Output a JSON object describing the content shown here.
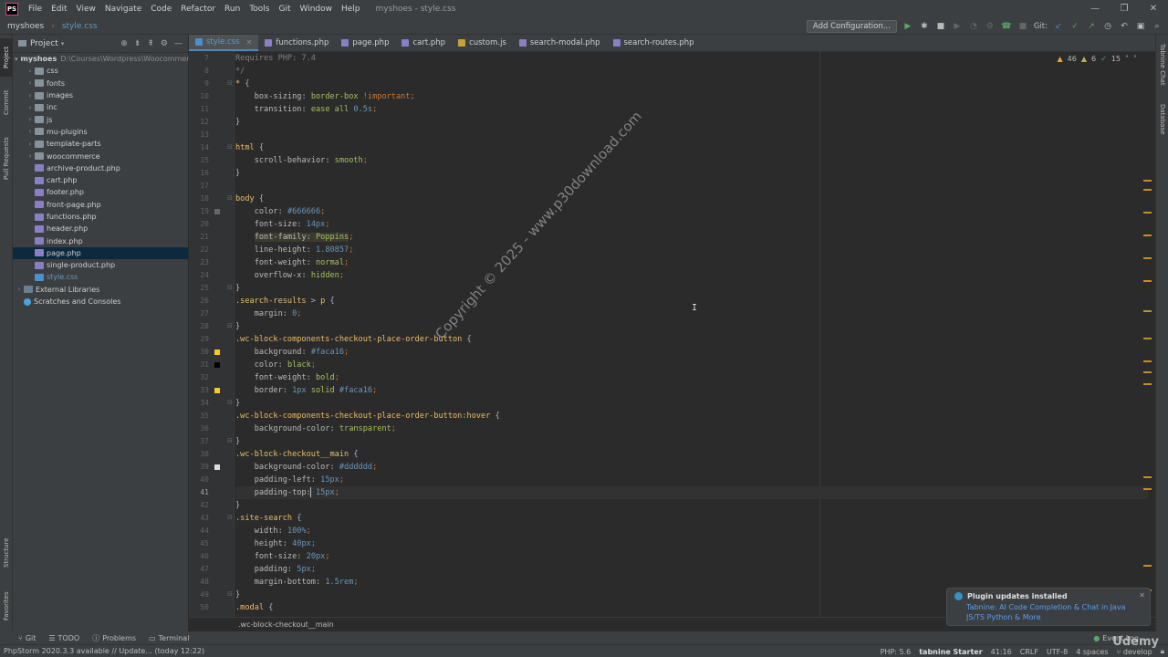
{
  "window": {
    "title": "myshoes - style.css",
    "menu": [
      "File",
      "Edit",
      "View",
      "Navigate",
      "Code",
      "Refactor",
      "Run",
      "Tools",
      "Git",
      "Window",
      "Help"
    ],
    "controls": [
      "—",
      "❐",
      "✕"
    ]
  },
  "navbar": {
    "project": "myshoes",
    "file": "style.css",
    "config_button": "Add Configuration...",
    "git_label": "Git:"
  },
  "project_panel": {
    "title": "Project",
    "root_name": "myshoes",
    "root_path": "D:\\Courses\\Wordpress\\Woocommerce",
    "items": [
      {
        "label": "css",
        "type": "folder"
      },
      {
        "label": "fonts",
        "type": "folder"
      },
      {
        "label": "images",
        "type": "folder"
      },
      {
        "label": "inc",
        "type": "folder"
      },
      {
        "label": "js",
        "type": "folder"
      },
      {
        "label": "mu-plugins",
        "type": "folder"
      },
      {
        "label": "template-parts",
        "type": "folder"
      },
      {
        "label": "woocommerce",
        "type": "folder"
      },
      {
        "label": "archive-product.php",
        "type": "php"
      },
      {
        "label": "cart.php",
        "type": "php"
      },
      {
        "label": "footer.php",
        "type": "php"
      },
      {
        "label": "front-page.php",
        "type": "php"
      },
      {
        "label": "functions.php",
        "type": "php"
      },
      {
        "label": "header.php",
        "type": "php"
      },
      {
        "label": "index.php",
        "type": "php"
      },
      {
        "label": "page.php",
        "type": "php"
      },
      {
        "label": "single-product.php",
        "type": "php"
      },
      {
        "label": "style.css",
        "type": "css"
      }
    ],
    "external_libraries": "External Libraries",
    "scratches": "Scratches and Consoles"
  },
  "left_strip": {
    "project": "Project",
    "commit": "Commit",
    "pull_requests": "Pull Requests",
    "structure": "Structure",
    "favorites": "Favorites"
  },
  "right_strip": {
    "tabnine": "Tabnine Chat",
    "database": "Database"
  },
  "tabs": [
    {
      "label": "style.css",
      "type": "css",
      "active": true
    },
    {
      "label": "functions.php",
      "type": "php",
      "active": false
    },
    {
      "label": "page.php",
      "type": "php",
      "active": false
    },
    {
      "label": "cart.php",
      "type": "php",
      "active": false
    },
    {
      "label": "custom.js",
      "type": "js",
      "active": false
    },
    {
      "label": "search-modal.php",
      "type": "php",
      "active": false
    },
    {
      "label": "search-routes.php",
      "type": "php",
      "active": false
    }
  ],
  "inspections": {
    "warnings": "46",
    "weak_warnings": "6",
    "typos": "15"
  },
  "code": {
    "line_numbers": [
      "7",
      "8",
      "9",
      "10",
      "11",
      "12",
      "13",
      "14",
      "15",
      "16",
      "17",
      "18",
      "19",
      "20",
      "21",
      "22",
      "23",
      "24",
      "25",
      "26",
      "27",
      "28",
      "29",
      "30",
      "31",
      "32",
      "33",
      "34",
      "35",
      "36",
      "37",
      "38",
      "39",
      "40",
      "41",
      "42",
      "43",
      "44",
      "45",
      "46",
      "47",
      "48",
      "49",
      "50"
    ],
    "current_line": "41",
    "line_1": "Requires PHP: 7.4",
    "line_2": "*/",
    "colors": {
      "swatch_666666": "#666666",
      "swatch_faca16": "#faca16",
      "swatch_black": "#000000",
      "swatch_dddddd": "#dddddd"
    }
  },
  "editor_breadcrumb": ".wc-block-checkout__main",
  "watermark": "Copyright © 2025 - www.p30download.com",
  "notification": {
    "title": "Plugin updates installed",
    "link1": "Tabnine: AI Code Completion & Chat in Java",
    "link2": "JS/TS Python & More"
  },
  "tool_windows": [
    "Git",
    "TODO",
    "Problems",
    "Terminal"
  ],
  "event_log": "Event Log",
  "status": {
    "message": "PhpStorm 2020.3.3 available // Update... (today 12:22)",
    "php": "PHP: 5.6",
    "tabnine": "tabnine Starter",
    "position": "41:16",
    "line_sep": "CRLF",
    "encoding": "UTF-8",
    "indent": "4 spaces",
    "branch": "develop"
  },
  "udemy": "Udemy"
}
